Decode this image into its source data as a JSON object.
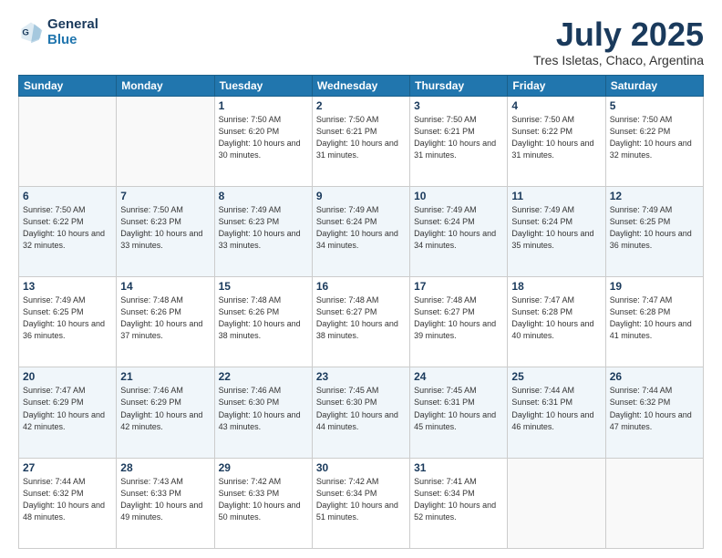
{
  "header": {
    "logo_line1": "General",
    "logo_line2": "Blue",
    "title": "July 2025",
    "subtitle": "Tres Isletas, Chaco, Argentina"
  },
  "days_of_week": [
    "Sunday",
    "Monday",
    "Tuesday",
    "Wednesday",
    "Thursday",
    "Friday",
    "Saturday"
  ],
  "weeks": [
    [
      {
        "day": "",
        "info": ""
      },
      {
        "day": "",
        "info": ""
      },
      {
        "day": "1",
        "info": "Sunrise: 7:50 AM\nSunset: 6:20 PM\nDaylight: 10 hours\nand 30 minutes."
      },
      {
        "day": "2",
        "info": "Sunrise: 7:50 AM\nSunset: 6:21 PM\nDaylight: 10 hours\nand 31 minutes."
      },
      {
        "day": "3",
        "info": "Sunrise: 7:50 AM\nSunset: 6:21 PM\nDaylight: 10 hours\nand 31 minutes."
      },
      {
        "day": "4",
        "info": "Sunrise: 7:50 AM\nSunset: 6:22 PM\nDaylight: 10 hours\nand 31 minutes."
      },
      {
        "day": "5",
        "info": "Sunrise: 7:50 AM\nSunset: 6:22 PM\nDaylight: 10 hours\nand 32 minutes."
      }
    ],
    [
      {
        "day": "6",
        "info": "Sunrise: 7:50 AM\nSunset: 6:22 PM\nDaylight: 10 hours\nand 32 minutes."
      },
      {
        "day": "7",
        "info": "Sunrise: 7:50 AM\nSunset: 6:23 PM\nDaylight: 10 hours\nand 33 minutes."
      },
      {
        "day": "8",
        "info": "Sunrise: 7:49 AM\nSunset: 6:23 PM\nDaylight: 10 hours\nand 33 minutes."
      },
      {
        "day": "9",
        "info": "Sunrise: 7:49 AM\nSunset: 6:24 PM\nDaylight: 10 hours\nand 34 minutes."
      },
      {
        "day": "10",
        "info": "Sunrise: 7:49 AM\nSunset: 6:24 PM\nDaylight: 10 hours\nand 34 minutes."
      },
      {
        "day": "11",
        "info": "Sunrise: 7:49 AM\nSunset: 6:24 PM\nDaylight: 10 hours\nand 35 minutes."
      },
      {
        "day": "12",
        "info": "Sunrise: 7:49 AM\nSunset: 6:25 PM\nDaylight: 10 hours\nand 36 minutes."
      }
    ],
    [
      {
        "day": "13",
        "info": "Sunrise: 7:49 AM\nSunset: 6:25 PM\nDaylight: 10 hours\nand 36 minutes."
      },
      {
        "day": "14",
        "info": "Sunrise: 7:48 AM\nSunset: 6:26 PM\nDaylight: 10 hours\nand 37 minutes."
      },
      {
        "day": "15",
        "info": "Sunrise: 7:48 AM\nSunset: 6:26 PM\nDaylight: 10 hours\nand 38 minutes."
      },
      {
        "day": "16",
        "info": "Sunrise: 7:48 AM\nSunset: 6:27 PM\nDaylight: 10 hours\nand 38 minutes."
      },
      {
        "day": "17",
        "info": "Sunrise: 7:48 AM\nSunset: 6:27 PM\nDaylight: 10 hours\nand 39 minutes."
      },
      {
        "day": "18",
        "info": "Sunrise: 7:47 AM\nSunset: 6:28 PM\nDaylight: 10 hours\nand 40 minutes."
      },
      {
        "day": "19",
        "info": "Sunrise: 7:47 AM\nSunset: 6:28 PM\nDaylight: 10 hours\nand 41 minutes."
      }
    ],
    [
      {
        "day": "20",
        "info": "Sunrise: 7:47 AM\nSunset: 6:29 PM\nDaylight: 10 hours\nand 42 minutes."
      },
      {
        "day": "21",
        "info": "Sunrise: 7:46 AM\nSunset: 6:29 PM\nDaylight: 10 hours\nand 42 minutes."
      },
      {
        "day": "22",
        "info": "Sunrise: 7:46 AM\nSunset: 6:30 PM\nDaylight: 10 hours\nand 43 minutes."
      },
      {
        "day": "23",
        "info": "Sunrise: 7:45 AM\nSunset: 6:30 PM\nDaylight: 10 hours\nand 44 minutes."
      },
      {
        "day": "24",
        "info": "Sunrise: 7:45 AM\nSunset: 6:31 PM\nDaylight: 10 hours\nand 45 minutes."
      },
      {
        "day": "25",
        "info": "Sunrise: 7:44 AM\nSunset: 6:31 PM\nDaylight: 10 hours\nand 46 minutes."
      },
      {
        "day": "26",
        "info": "Sunrise: 7:44 AM\nSunset: 6:32 PM\nDaylight: 10 hours\nand 47 minutes."
      }
    ],
    [
      {
        "day": "27",
        "info": "Sunrise: 7:44 AM\nSunset: 6:32 PM\nDaylight: 10 hours\nand 48 minutes."
      },
      {
        "day": "28",
        "info": "Sunrise: 7:43 AM\nSunset: 6:33 PM\nDaylight: 10 hours\nand 49 minutes."
      },
      {
        "day": "29",
        "info": "Sunrise: 7:42 AM\nSunset: 6:33 PM\nDaylight: 10 hours\nand 50 minutes."
      },
      {
        "day": "30",
        "info": "Sunrise: 7:42 AM\nSunset: 6:34 PM\nDaylight: 10 hours\nand 51 minutes."
      },
      {
        "day": "31",
        "info": "Sunrise: 7:41 AM\nSunset: 6:34 PM\nDaylight: 10 hours\nand 52 minutes."
      },
      {
        "day": "",
        "info": ""
      },
      {
        "day": "",
        "info": ""
      }
    ]
  ]
}
